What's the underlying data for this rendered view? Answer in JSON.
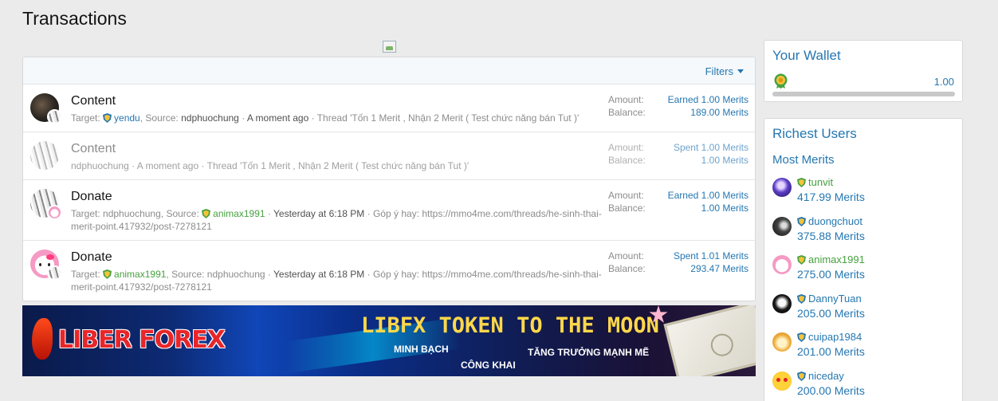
{
  "page": {
    "title": "Transactions"
  },
  "filters": {
    "label": "Filters"
  },
  "transactions": [
    {
      "title": "Content",
      "target_label": "Target:",
      "target_user": "yendu",
      "source_label": ", Source:",
      "source_user": "ndphuochung",
      "time": "A moment ago",
      "detail": "Thread 'Tốn 1 Merit , Nhận 2 Merit ( Test chức năng bán Tut )'",
      "amount_label": "Amount:",
      "amount_value": "Earned 1.00 Merits",
      "balance_label": "Balance:",
      "balance_value": "189.00 Merits"
    },
    {
      "title": "Content",
      "source_user": "ndphuochung",
      "time": "A moment ago",
      "detail": "Thread 'Tốn 1 Merit , Nhận 2 Merit ( Test chức năng bán Tut )'",
      "amount_label": "Amount:",
      "amount_value": "Spent 1.00 Merits",
      "balance_label": "Balance:",
      "balance_value": "1.00 Merits"
    },
    {
      "title": "Donate",
      "target_label": "Target:",
      "target_user": "ndphuochung",
      "source_label": ", Source:",
      "source_user": "animax1991",
      "time": "Yesterday at 6:18 PM",
      "detail": "Góp ý hay: https://mmo4me.com/threads/he-sinh-thai-merit-point.417932/post-7278121",
      "amount_label": "Amount:",
      "amount_value": "Earned 1.00 Merits",
      "balance_label": "Balance:",
      "balance_value": "1.00 Merits"
    },
    {
      "title": "Donate",
      "target_label": "Target:",
      "target_user": "animax1991",
      "source_label": ", Source:",
      "source_user": "ndphuochung",
      "time": "Yesterday at 6:18 PM",
      "detail": "Góp ý hay: https://mmo4me.com/threads/he-sinh-thai-merit-point.417932/post-7278121",
      "amount_label": "Amount:",
      "amount_value": "Spent 1.01 Merits",
      "balance_label": "Balance:",
      "balance_value": "293.47 Merits"
    }
  ],
  "banner": {
    "logo": "LIBER FOREX",
    "headline": "LIBFX TOKEN TO THE MOON",
    "sub1": "MINH BẠCH",
    "sub2": "CÔNG KHAI",
    "sub3": "TĂNG TRƯỞNG MẠNH MẼ"
  },
  "wallet": {
    "title": "Your Wallet",
    "amount": "1.00",
    "progress": 1.0
  },
  "richest": {
    "title": "Richest Users",
    "subtitle": "Most Merits",
    "users": [
      {
        "name": "tunvit",
        "merits": "417.99 Merits",
        "badge": "green"
      },
      {
        "name": "duongchuot",
        "merits": "375.88 Merits",
        "badge": "blue"
      },
      {
        "name": "animax1991",
        "merits": "275.00 Merits",
        "badge": "green"
      },
      {
        "name": "DannyTuan",
        "merits": "205.00 Merits",
        "badge": "blue"
      },
      {
        "name": "cuipap1984",
        "merits": "201.00 Merits",
        "badge": "blue"
      },
      {
        "name": "niceday",
        "merits": "200.00 Merits",
        "badge": "blue"
      }
    ]
  },
  "colors": {
    "accent": "#2577b1",
    "green_user": "#47a140",
    "background": "#ebebeb"
  }
}
